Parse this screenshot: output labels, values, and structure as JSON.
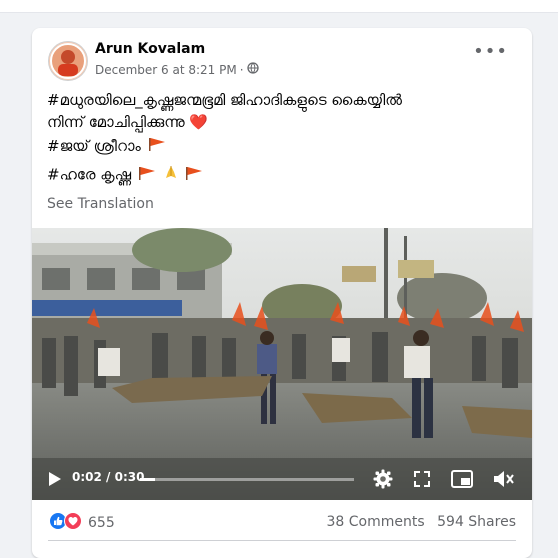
{
  "post": {
    "author": "Arun Kovalam",
    "timestamp": "December 6 at 8:21 PM",
    "visibility_icon": "globe-icon",
    "text_line1": "#മധുരയിലെ_കൃഷ്ണജന്മഭൂമി ജിഹാദികളുടെ കൈയ്യിൽ",
    "text_line2": "നിന്ന് മോചിപ്പിക്കുന്നു ❤️",
    "text_line3": "#ജയ് ശ്രീറാം",
    "text_line4": "#ഹരേ കൃഷ്ണ",
    "see_translation": "See Translation"
  },
  "video": {
    "current_time": "0:02",
    "duration": "0:30",
    "progress": 0.07
  },
  "footer": {
    "reaction_count": "655",
    "comments": "38 Comments",
    "shares": "594 Shares"
  },
  "colors": {
    "like_blue": "#1877f2",
    "love_red": "#f33e58",
    "flag_orange": "#e8501d"
  }
}
